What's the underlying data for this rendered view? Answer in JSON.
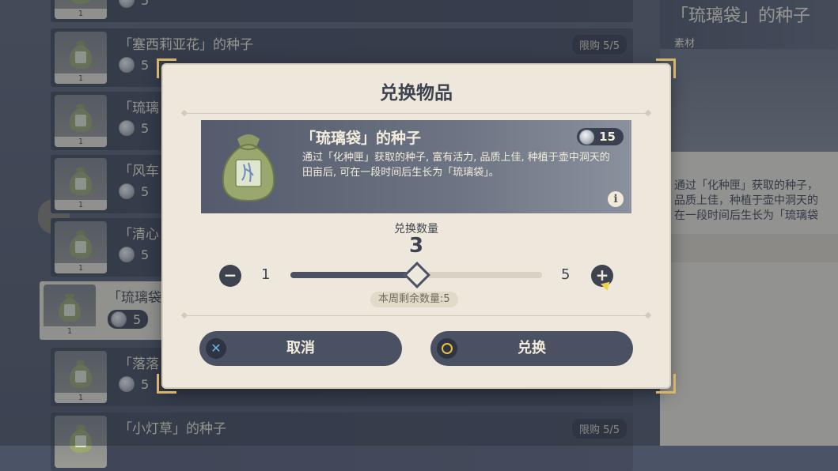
{
  "shop_list": {
    "rows": [
      {
        "name": "",
        "price": "5",
        "qty": "1",
        "limit": ""
      },
      {
        "name": "「塞西莉亚花」的种子",
        "price": "5",
        "qty": "1",
        "limit": "限购 5/5"
      },
      {
        "name": "「琉璃",
        "price": "5",
        "qty": "1",
        "limit": ""
      },
      {
        "name": "「风车",
        "price": "5",
        "qty": "1",
        "limit": ""
      },
      {
        "name": "「清心",
        "price": "5",
        "qty": "1",
        "limit": ""
      },
      {
        "name": "「琉璃袋",
        "price": "5",
        "qty": "1",
        "limit": "",
        "selected": true
      },
      {
        "name": "「落落",
        "price": "5",
        "qty": "1",
        "limit": ""
      },
      {
        "name": "「小灯草」的种子",
        "price": "",
        "qty": "",
        "limit": "限购 5/5"
      }
    ]
  },
  "detail": {
    "title": "「琉璃袋」的种子",
    "category": "素材",
    "description_lines": [
      "通过「化种匣」获取的种子，",
      "品质上佳，种植于壶中洞天的",
      "在一段时间后生长为「琉璃袋"
    ]
  },
  "modal": {
    "title": "兑换物品",
    "item": {
      "name": "「琉璃袋」的种子",
      "cost": "15",
      "description": "通过「化种匣」获取的种子, 富有活力, 品质上佳, 种植于壶中洞天的田亩后, 可在一段时间后生长为「琉璃袋」。",
      "info_glyph": "i"
    },
    "quantity": {
      "label": "兑换数量",
      "value": "3",
      "min": "1",
      "max": "5",
      "slider_fraction": 0.5,
      "remaining": "本周剩余数量:5",
      "minus_glyph": "−",
      "plus_glyph": "+"
    },
    "buttons": {
      "cancel": "取消",
      "confirm": "兑换",
      "cancel_glyph": "✕"
    }
  },
  "colors": {
    "panel_dark": "#3f4657",
    "modal_bg": "#eee8dc",
    "accent_gold": "#d7b36b",
    "button_dark": "#4a5162"
  }
}
